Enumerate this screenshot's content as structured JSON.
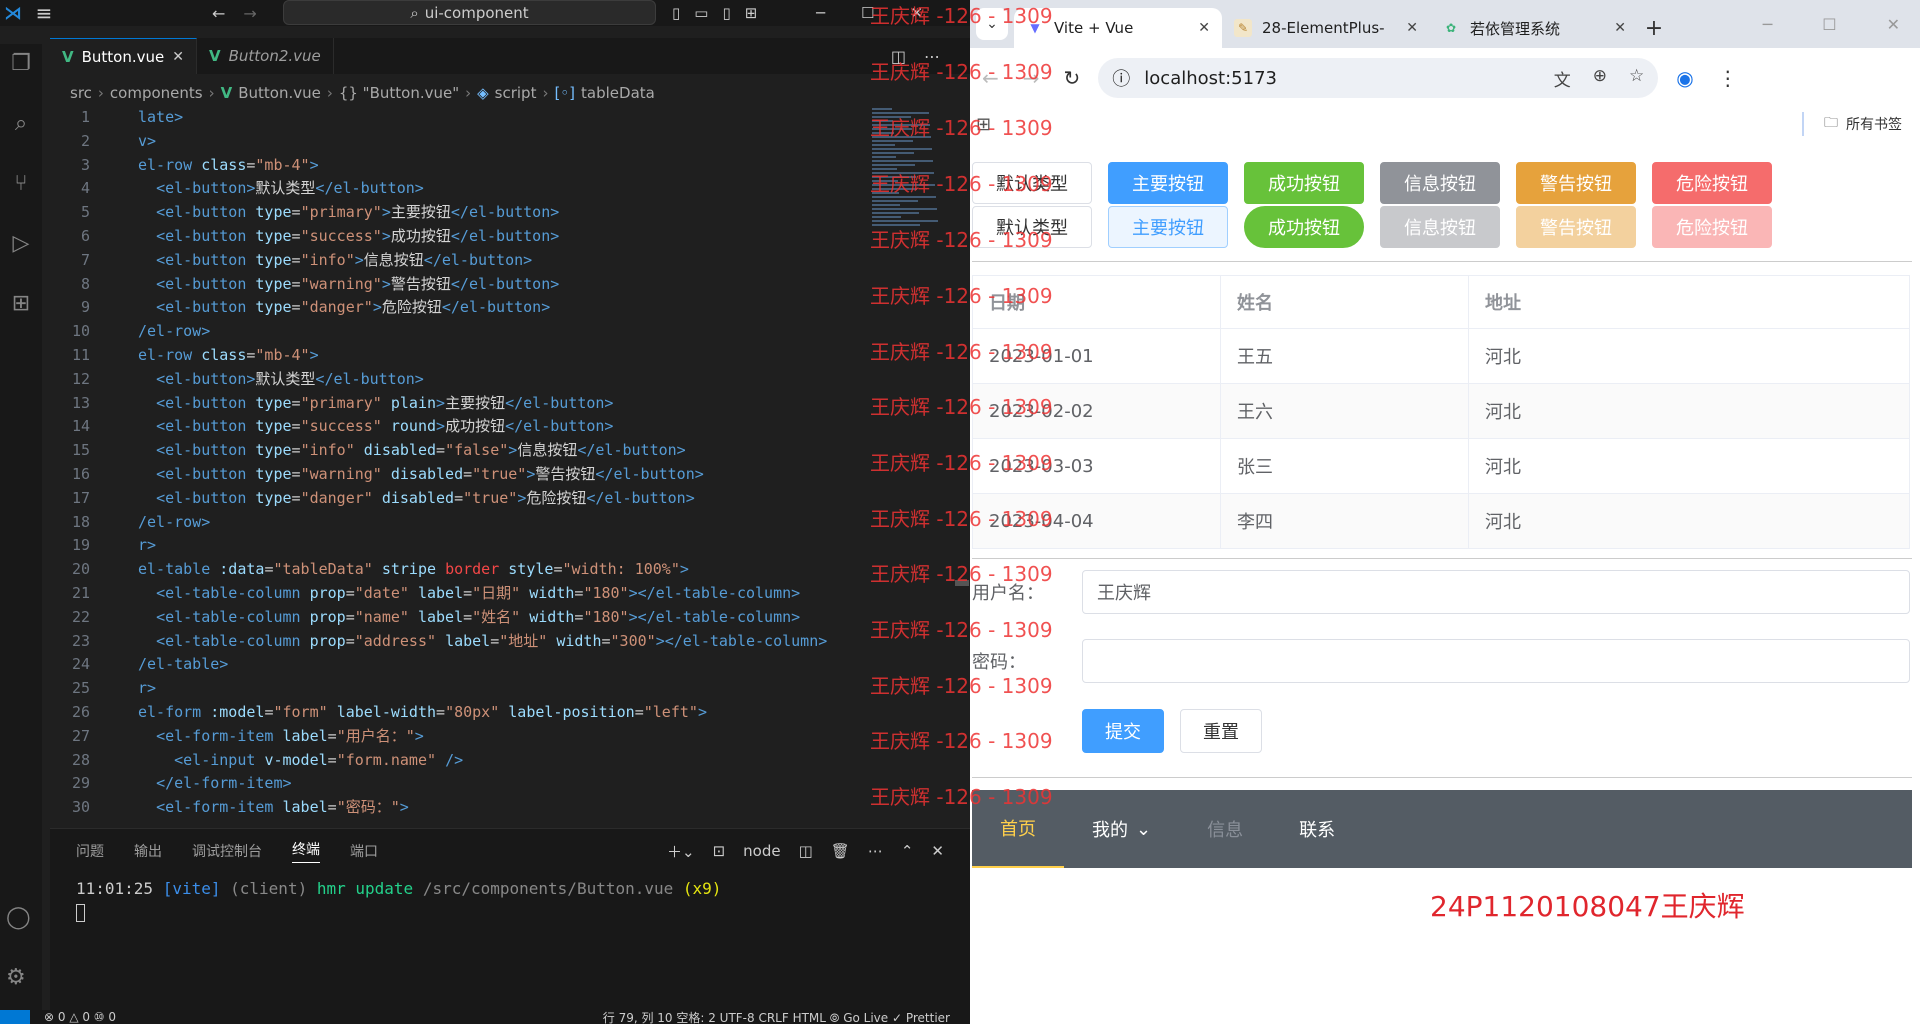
{
  "vscode": {
    "search_text": "ui-component",
    "tabs": [
      {
        "label": "Button.vue",
        "active": true
      },
      {
        "label": "Button2.vue",
        "active": false
      }
    ],
    "breadcrumb": [
      "src",
      "components",
      "Button.vue",
      "{} \"Button.vue\"",
      "script",
      "tableData"
    ],
    "code_lines": [
      {
        "n": "1",
        "html": "<span class='tag'>late&gt;</span>"
      },
      {
        "n": "2",
        "html": "<span class='tag'>v&gt;</span>"
      },
      {
        "n": "3",
        "html": "<span class='tag'>el-row</span> <span class='attr'>class</span>=<span class='str'>\"mb-4\"</span><span class='tag'>&gt;</span>"
      },
      {
        "n": "4",
        "html": "  <span class='tag'>&lt;el-button&gt;</span><span class='txt'>默认类型</span><span class='tag'>&lt;/el-button&gt;</span>"
      },
      {
        "n": "5",
        "html": "  <span class='tag'>&lt;el-button</span> <span class='attr'>type</span>=<span class='str'>\"primary\"</span><span class='tag'>&gt;</span><span class='txt'>主要按钮</span><span class='tag'>&lt;/el-button&gt;</span>"
      },
      {
        "n": "6",
        "html": "  <span class='tag'>&lt;el-button</span> <span class='attr'>type</span>=<span class='str'>\"success\"</span><span class='tag'>&gt;</span><span class='txt'>成功按钮</span><span class='tag'>&lt;/el-button&gt;</span>"
      },
      {
        "n": "7",
        "html": "  <span class='tag'>&lt;el-button</span> <span class='attr'>type</span>=<span class='str'>\"info\"</span><span class='tag'>&gt;</span><span class='txt'>信息按钮</span><span class='tag'>&lt;/el-button&gt;</span>"
      },
      {
        "n": "8",
        "html": "  <span class='tag'>&lt;el-button</span> <span class='attr'>type</span>=<span class='str'>\"warning\"</span><span class='tag'>&gt;</span><span class='txt'>警告按钮</span><span class='tag'>&lt;/el-button&gt;</span>"
      },
      {
        "n": "9",
        "html": "  <span class='tag'>&lt;el-button</span> <span class='attr'>type</span>=<span class='str'>\"danger\"</span><span class='tag'>&gt;</span><span class='txt'>危险按钮</span><span class='tag'>&lt;/el-button&gt;</span>"
      },
      {
        "n": "10",
        "html": "<span class='tag'>/el-row&gt;</span>"
      },
      {
        "n": "11",
        "html": "<span class='tag'>el-row</span> <span class='attr'>class</span>=<span class='str'>\"mb-4\"</span><span class='tag'>&gt;</span>"
      },
      {
        "n": "12",
        "html": "  <span class='tag'>&lt;el-button&gt;</span><span class='txt'>默认类型</span><span class='tag'>&lt;/el-button&gt;</span>"
      },
      {
        "n": "13",
        "html": "  <span class='tag'>&lt;el-button</span> <span class='attr'>type</span>=<span class='str'>\"primary\"</span> <span class='attr'>plain</span><span class='tag'>&gt;</span><span class='txt'>主要按钮</span><span class='tag'>&lt;/el-button&gt;</span>"
      },
      {
        "n": "14",
        "html": "  <span class='tag'>&lt;el-button</span> <span class='attr'>type</span>=<span class='str'>\"success\"</span> <span class='attr'>round</span><span class='tag'>&gt;</span><span class='txt'>成功按钮</span><span class='tag'>&lt;/el-button&gt;</span>"
      },
      {
        "n": "15",
        "html": "  <span class='tag'>&lt;el-button</span> <span class='attr'>type</span>=<span class='str'>\"info\"</span> <span class='attr'>disabled</span>=<span class='str'>\"false\"</span><span class='tag'>&gt;</span><span class='txt'>信息按钮</span><span class='tag'>&lt;/el-button&gt;</span>"
      },
      {
        "n": "16",
        "html": "  <span class='tag'>&lt;el-button</span> <span class='attr'>type</span>=<span class='str'>\"warning\"</span> <span class='attr'>disabled</span>=<span class='str'>\"true\"</span><span class='tag'>&gt;</span><span class='txt'>警告按钮</span><span class='tag'>&lt;/el-button&gt;</span>"
      },
      {
        "n": "17",
        "html": "  <span class='tag'>&lt;el-button</span> <span class='attr'>type</span>=<span class='str'>\"danger\"</span> <span class='attr'>disabled</span>=<span class='str'>\"true\"</span><span class='tag'>&gt;</span><span class='txt'>危险按钮</span><span class='tag'>&lt;/el-button&gt;</span>"
      },
      {
        "n": "18",
        "html": "<span class='tag'>/el-row&gt;</span>"
      },
      {
        "n": "19",
        "html": "<span class='tag'>r&gt;</span>"
      },
      {
        "n": "20",
        "html": "<span class='tag'>el-table</span> <span class='attr'>:data</span>=<span class='str'>\"tableData\"</span> <span class='attr'>stripe</span> <span class='red-attr'>border</span> <span class='attr'>style</span>=<span class='str'>\"width: 100%\"</span><span class='tag'>&gt;</span>"
      },
      {
        "n": "21",
        "html": "  <span class='tag'>&lt;el-table-column</span> <span class='attr'>prop</span>=<span class='str'>\"date\"</span> <span class='attr'>label</span>=<span class='str'>\"日期\"</span> <span class='attr'>width</span>=<span class='str'>\"180\"</span><span class='tag'>&gt;&lt;/el-table-column&gt;</span>"
      },
      {
        "n": "22",
        "html": "  <span class='tag'>&lt;el-table-column</span> <span class='attr'>prop</span>=<span class='str'>\"name\"</span> <span class='attr'>label</span>=<span class='str'>\"姓名\"</span> <span class='attr'>width</span>=<span class='str'>\"180\"</span><span class='tag'>&gt;&lt;/el-table-column&gt;</span>"
      },
      {
        "n": "23",
        "html": "  <span class='tag'>&lt;el-table-column</span> <span class='attr'>prop</span>=<span class='str'>\"address\"</span> <span class='attr'>label</span>=<span class='str'>\"地址\"</span> <span class='attr'>width</span>=<span class='str'>\"300\"</span><span class='tag'>&gt;&lt;/el-table-column&gt;</span>"
      },
      {
        "n": "24",
        "html": "<span class='tag'>/el-table&gt;</span>"
      },
      {
        "n": "25",
        "html": "<span class='tag'>r&gt;</span>"
      },
      {
        "n": "26",
        "html": "<span class='tag'>el-form</span> <span class='attr'>:model</span>=<span class='str'>\"form\"</span> <span class='attr'>label-width</span>=<span class='str'>\"80px\"</span> <span class='attr'>label-position</span>=<span class='str'>\"left\"</span><span class='tag'>&gt;</span>"
      },
      {
        "n": "27",
        "html": "  <span class='tag'>&lt;el-form-item</span> <span class='attr'>label</span>=<span class='str'>\"用户名：\"</span><span class='tag'>&gt;</span>"
      },
      {
        "n": "28",
        "html": "    <span class='tag'>&lt;el-input</span> <span class='attr'>v-model</span>=<span class='str'>\"form.name\"</span> <span class='tag'>/&gt;</span>"
      },
      {
        "n": "29",
        "html": "  <span class='tag'>&lt;/el-form-item&gt;</span>"
      },
      {
        "n": "30",
        "html": "  <span class='tag'>&lt;el-form-item</span> <span class='attr'>label</span>=<span class='str'>\"密码：\"</span><span class='tag'>&gt;</span>"
      }
    ],
    "panel_tabs": [
      "问题",
      "输出",
      "调试控制台",
      "终端",
      "端口"
    ],
    "panel_active": "终端",
    "terminal_shell": "node",
    "terminal": {
      "time": "11:01:25",
      "tag": "[vite]",
      "client": "(client)",
      "action": "hmr update",
      "path": "/src/components/Button.vue",
      "count": "(x9)"
    },
    "status_left": "⊗ 0 △ 0   ⑩ 0",
    "status_right": "行 79, 列 10   空格: 2   UTF-8   CRLF   HTML   ⦾ Go Live   ✓ Prettier"
  },
  "browser": {
    "tabs": [
      {
        "title": "Vite + Vue",
        "active": true,
        "icon": "vite-icon"
      },
      {
        "title": "28-ElementPlus-",
        "active": false,
        "icon": "doc-icon"
      },
      {
        "title": "若依管理系统",
        "active": false,
        "icon": "ruoyi-icon"
      }
    ],
    "url": "localhost:5173",
    "bookmarks_label": "所有书签",
    "buttons_row1": [
      {
        "label": "默认类型",
        "style": "default"
      },
      {
        "label": "主要按钮",
        "style": "primary"
      },
      {
        "label": "成功按钮",
        "style": "success"
      },
      {
        "label": "信息按钮",
        "style": "info"
      },
      {
        "label": "警告按钮",
        "style": "warning"
      },
      {
        "label": "危险按钮",
        "style": "danger"
      }
    ],
    "buttons_row2": [
      {
        "label": "默认类型",
        "style": "default"
      },
      {
        "label": "主要按钮",
        "style": "primary-plain"
      },
      {
        "label": "成功按钮",
        "style": "success round"
      },
      {
        "label": "信息按钮",
        "style": "info-dis"
      },
      {
        "label": "警告按钮",
        "style": "warning-dis"
      },
      {
        "label": "危险按钮",
        "style": "danger-dis"
      }
    ],
    "table": {
      "headers": [
        "日期",
        "姓名",
        "地址"
      ],
      "rows": [
        [
          "2023-01-01",
          "王五",
          "河北"
        ],
        [
          "2023-02-02",
          "王六",
          "河北"
        ],
        [
          "2023-03-03",
          "张三",
          "河北"
        ],
        [
          "2023-04-04",
          "李四",
          "河北"
        ]
      ]
    },
    "form": {
      "username_label": "用户名：",
      "username_value": "王庆辉",
      "password_label": "密码：",
      "password_value": "",
      "submit_label": "提交",
      "reset_label": "重置"
    },
    "menu": [
      {
        "label": "首页",
        "state": "active"
      },
      {
        "label": "我的",
        "state": "submenu"
      },
      {
        "label": "信息",
        "state": "disabled"
      },
      {
        "label": "联系",
        "state": "normal"
      }
    ],
    "student_id": "24P1120108047王庆辉"
  },
  "watermark": "王庆辉 -126 - 1309"
}
